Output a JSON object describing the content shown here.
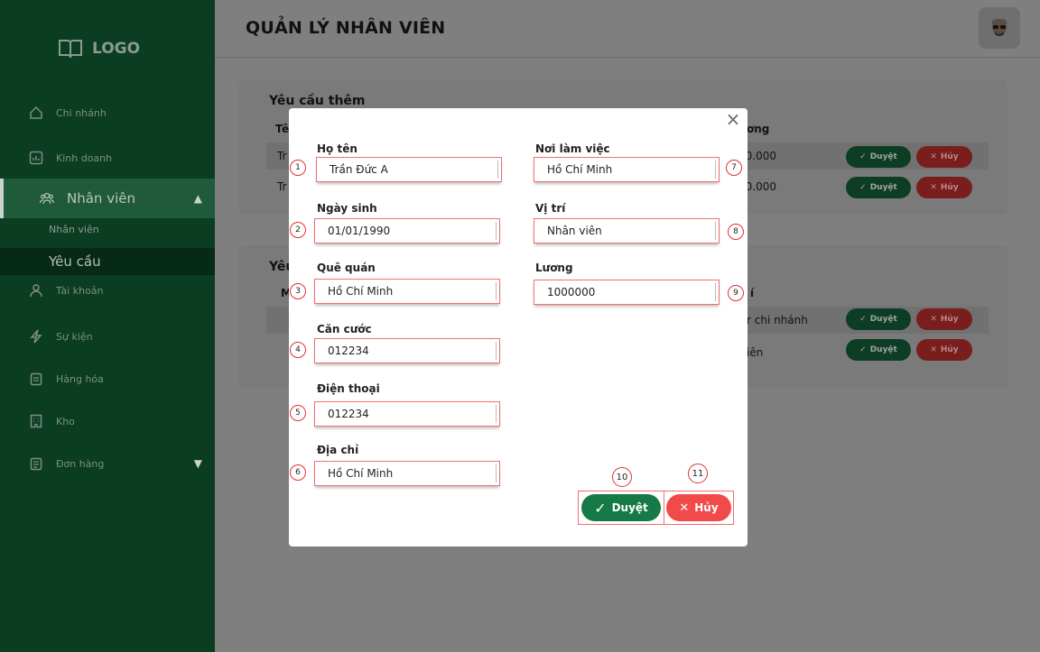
{
  "sidebar": {
    "logo_text": "LOGO",
    "items": [
      {
        "label": "Chi nhánh",
        "icon": "home-icon"
      },
      {
        "label": "Kinh doanh",
        "icon": "chart-icon"
      },
      {
        "label": "Nhân viên",
        "icon": "users-icon"
      },
      {
        "label": "Tài khoản",
        "icon": "account-icon"
      },
      {
        "label": "Sự kiện",
        "icon": "lightning-icon"
      },
      {
        "label": "Hàng hóa",
        "icon": "clipboard-icon"
      },
      {
        "label": "Kho",
        "icon": "building-icon"
      },
      {
        "label": "Đơn hàng",
        "icon": "order-icon"
      }
    ],
    "sub_items": [
      {
        "label": "Nhân viên"
      },
      {
        "label": "Yêu cầu"
      }
    ]
  },
  "header": {
    "title": "QUẢN LÝ NHÂN VIÊN"
  },
  "background": {
    "card1_title": "Yêu cầu thêm",
    "card1_col_a": "Tê",
    "card1_col_b": "ơng",
    "card1_rows": [
      {
        "lead": "Tr",
        "salary": ")0.000"
      },
      {
        "lead": "Tr",
        "salary": ")0.000"
      }
    ],
    "card2_title": "Yêu",
    "card2_col_a": "M",
    "card2_col_b": "í",
    "card2_rows": [
      {
        "tail": "r chi nhánh"
      },
      {
        "tail": "iên"
      }
    ],
    "approve_label": "Duyệt",
    "cancel_label": "Hủy"
  },
  "modal": {
    "fields_left": [
      {
        "marker": "1",
        "label": "Họ tên",
        "value": "Trần Đức A"
      },
      {
        "marker": "2",
        "label": "Ngày sinh",
        "value": "01/01/1990"
      },
      {
        "marker": "3",
        "label": "Quê quán",
        "value": "Hồ Chí Minh"
      },
      {
        "marker": "4",
        "label": "Căn cước",
        "value": "012234"
      },
      {
        "marker": "5",
        "label": "Điện thoại",
        "value": "012234"
      },
      {
        "marker": "6",
        "label": "Địa chỉ",
        "value": "Hồ Chí Minh"
      }
    ],
    "fields_right": [
      {
        "marker": "7",
        "label": "Nơi làm việc",
        "value": "Hồ Chí Minh"
      },
      {
        "marker": "8",
        "label": "Vị trí",
        "value": "Nhân viên"
      },
      {
        "marker": "9",
        "label": "Lương",
        "value": "1000000"
      }
    ],
    "approve_marker": "10",
    "cancel_marker": "11",
    "approve_label": "Duyệt",
    "cancel_label": "Hủy"
  },
  "colors": {
    "sidebar_bg": "#0b3d22",
    "approve_green": "#157a45",
    "cancel_red": "#f04a4a",
    "annotation_red": "#f07070"
  }
}
